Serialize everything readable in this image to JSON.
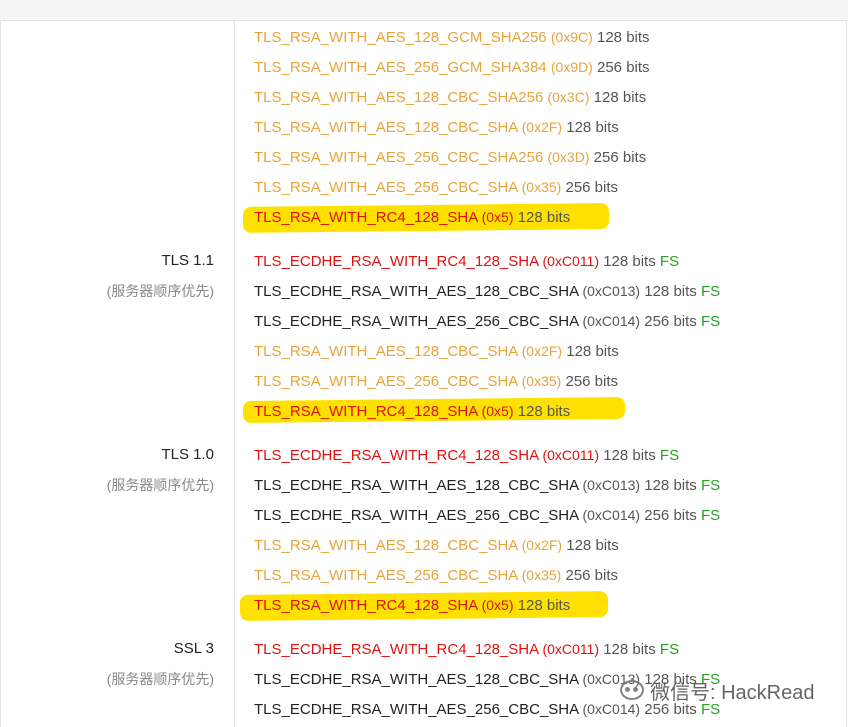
{
  "groups": [
    {
      "protocol": "",
      "preference": "",
      "rows": [
        {
          "cipher": "TLS_RSA_WITH_AES_128_GCM_SHA256",
          "hex": "(0x9C)",
          "bits": "128 bits",
          "fs": "",
          "level": "warn"
        },
        {
          "cipher": "TLS_RSA_WITH_AES_256_GCM_SHA384",
          "hex": "(0x9D)",
          "bits": "256 bits",
          "fs": "",
          "level": "warn"
        },
        {
          "cipher": "TLS_RSA_WITH_AES_128_CBC_SHA256",
          "hex": "(0x3C)",
          "bits": "128 bits",
          "fs": "",
          "level": "warn"
        },
        {
          "cipher": "TLS_RSA_WITH_AES_128_CBC_SHA",
          "hex": "(0x2F)",
          "bits": "128 bits",
          "fs": "",
          "level": "warn"
        },
        {
          "cipher": "TLS_RSA_WITH_AES_256_CBC_SHA256",
          "hex": "(0x3D)",
          "bits": "256 bits",
          "fs": "",
          "level": "warn"
        },
        {
          "cipher": "TLS_RSA_WITH_AES_256_CBC_SHA",
          "hex": "(0x35)",
          "bits": "256 bits",
          "fs": "",
          "level": "warn"
        },
        {
          "cipher": "TLS_RSA_WITH_RC4_128_SHA",
          "hex": "(0x5)",
          "bits": "128 bits",
          "fs": "",
          "level": "bad"
        }
      ]
    },
    {
      "protocol": "TLS 1.1",
      "preference": "(服务器顺序优先)",
      "rows": [
        {
          "cipher": "TLS_ECDHE_RSA_WITH_RC4_128_SHA",
          "hex": "(0xC011)",
          "bits": "128 bits",
          "fs": "FS",
          "level": "bad"
        },
        {
          "cipher": "TLS_ECDHE_RSA_WITH_AES_128_CBC_SHA",
          "hex": "(0xC013)",
          "bits": "128 bits",
          "fs": "FS",
          "level": "good"
        },
        {
          "cipher": "TLS_ECDHE_RSA_WITH_AES_256_CBC_SHA",
          "hex": "(0xC014)",
          "bits": "256 bits",
          "fs": "FS",
          "level": "good"
        },
        {
          "cipher": "TLS_RSA_WITH_AES_128_CBC_SHA",
          "hex": "(0x2F)",
          "bits": "128 bits",
          "fs": "",
          "level": "warn"
        },
        {
          "cipher": "TLS_RSA_WITH_AES_256_CBC_SHA",
          "hex": "(0x35)",
          "bits": "256 bits",
          "fs": "",
          "level": "warn"
        },
        {
          "cipher": "TLS_RSA_WITH_RC4_128_SHA",
          "hex": "(0x5)",
          "bits": "128 bits",
          "fs": "",
          "level": "bad"
        }
      ]
    },
    {
      "protocol": "TLS 1.0",
      "preference": "(服务器顺序优先)",
      "rows": [
        {
          "cipher": "TLS_ECDHE_RSA_WITH_RC4_128_SHA",
          "hex": "(0xC011)",
          "bits": "128 bits",
          "fs": "FS",
          "level": "bad"
        },
        {
          "cipher": "TLS_ECDHE_RSA_WITH_AES_128_CBC_SHA",
          "hex": "(0xC013)",
          "bits": "128 bits",
          "fs": "FS",
          "level": "good"
        },
        {
          "cipher": "TLS_ECDHE_RSA_WITH_AES_256_CBC_SHA",
          "hex": "(0xC014)",
          "bits": "256 bits",
          "fs": "FS",
          "level": "good"
        },
        {
          "cipher": "TLS_RSA_WITH_AES_128_CBC_SHA",
          "hex": "(0x2F)",
          "bits": "128 bits",
          "fs": "",
          "level": "warn"
        },
        {
          "cipher": "TLS_RSA_WITH_AES_256_CBC_SHA",
          "hex": "(0x35)",
          "bits": "256 bits",
          "fs": "",
          "level": "warn"
        },
        {
          "cipher": "TLS_RSA_WITH_RC4_128_SHA",
          "hex": "(0x5)",
          "bits": "128 bits",
          "fs": "",
          "level": "bad"
        }
      ]
    },
    {
      "protocol": "SSL 3",
      "preference": "(服务器顺序优先)",
      "rows": [
        {
          "cipher": "TLS_ECDHE_RSA_WITH_RC4_128_SHA",
          "hex": "(0xC011)",
          "bits": "128 bits",
          "fs": "FS",
          "level": "bad"
        },
        {
          "cipher": "TLS_ECDHE_RSA_WITH_AES_128_CBC_SHA",
          "hex": "(0xC013)",
          "bits": "128 bits",
          "fs": "FS",
          "level": "good"
        },
        {
          "cipher": "TLS_ECDHE_RSA_WITH_AES_256_CBC_SHA",
          "hex": "(0xC014)",
          "bits": "256 bits",
          "fs": "FS",
          "level": "good"
        }
      ]
    }
  ],
  "watermark": {
    "text": "微信号: HackRead",
    "icon": "wechat-icon"
  },
  "colors": {
    "warn": "#e8a33a",
    "bad": "#e01010",
    "good": "#222222",
    "fs": "#22a322",
    "highlight": "#ffe100"
  }
}
